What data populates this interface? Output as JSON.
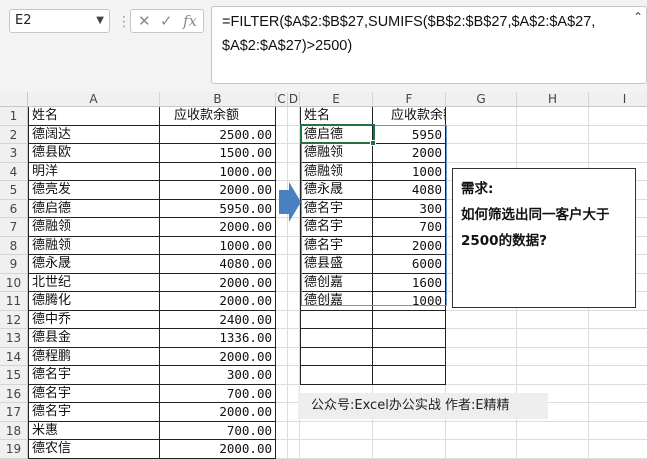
{
  "name_box": "E2",
  "formula_line1": "=FILTER($A$2:$B$27,SUMIFS($B$2:$B$27,$A$2:$A$27,",
  "formula_line2": "$A$2:$A$27)>2500)",
  "columns": [
    "A",
    "B",
    "C",
    "D",
    "E",
    "F",
    "G",
    "H",
    "I"
  ],
  "rows": [
    "1",
    "2",
    "3",
    "4",
    "5",
    "6",
    "7",
    "8",
    "9",
    "10",
    "11",
    "12",
    "13",
    "14",
    "15",
    "16",
    "17",
    "18",
    "19"
  ],
  "source": {
    "header": [
      "姓名",
      "应收款余额"
    ],
    "data": [
      [
        "德阔达",
        "2500.00"
      ],
      [
        "德县欧",
        "1500.00"
      ],
      [
        "明洋",
        "1000.00"
      ],
      [
        "德亮发",
        "2000.00"
      ],
      [
        "德启德",
        "5950.00"
      ],
      [
        "德融领",
        "2000.00"
      ],
      [
        "德融领",
        "1000.00"
      ],
      [
        "德永晟",
        "4080.00"
      ],
      [
        "北世纪",
        "2000.00"
      ],
      [
        "德腾化",
        "2000.00"
      ],
      [
        "德中乔",
        "2400.00"
      ],
      [
        "德县金",
        "1336.00"
      ],
      [
        "德程鹏",
        "2000.00"
      ],
      [
        "德名宇",
        "300.00"
      ],
      [
        "德名宇",
        "700.00"
      ],
      [
        "德名宇",
        "2000.00"
      ],
      [
        "米惠",
        "700.00"
      ],
      [
        "德农信",
        "2000.00"
      ]
    ]
  },
  "result": {
    "header": [
      "姓名",
      "应收款余额"
    ],
    "data": [
      [
        "德启德",
        "5950"
      ],
      [
        "德融领",
        "2000"
      ],
      [
        "德融领",
        "1000"
      ],
      [
        "德永晟",
        "4080"
      ],
      [
        "德名宇",
        "300"
      ],
      [
        "德名宇",
        "700"
      ],
      [
        "德名宇",
        "2000"
      ],
      [
        "德县盛",
        "6000"
      ],
      [
        "德创嘉",
        "1600"
      ],
      [
        "德创嘉",
        "1000"
      ]
    ]
  },
  "note": {
    "title": "需求:",
    "line1": "如何筛选出同一客户大于",
    "line2": "2500的数据?"
  },
  "credit": "公众号:Excel办公实战  作者:E精精"
}
